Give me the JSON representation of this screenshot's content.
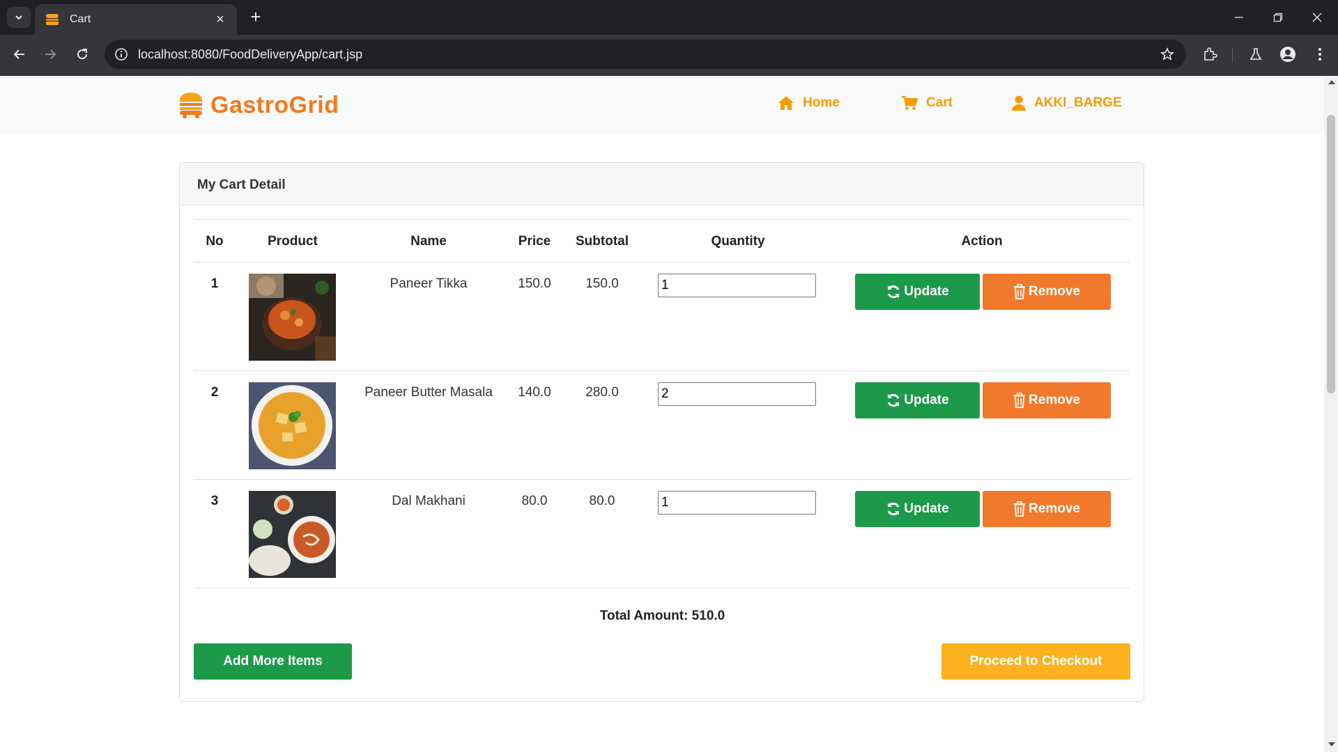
{
  "browser": {
    "tab_title": "Cart",
    "url": "localhost:8080/FoodDeliveryApp/cart.jsp"
  },
  "site": {
    "brand": "GastroGrid",
    "nav": {
      "home": "Home",
      "cart": "Cart",
      "user": "AKKI_BARGE"
    },
    "colors": {
      "brand_orange": "#f07b1e",
      "nav_yellow": "#f59c00",
      "update_green": "#1c9a4a",
      "remove_orange": "#f0792b",
      "checkout_yellow": "#fbb21e"
    }
  },
  "cart": {
    "title": "My Cart Detail",
    "headers": {
      "no": "No",
      "product": "Product",
      "name": "Name",
      "price": "Price",
      "subtotal": "Subtotal",
      "quantity": "Quantity",
      "action": "Action"
    },
    "rows": [
      {
        "no": "1",
        "name": "Paneer Tikka",
        "price": "150.0",
        "subtotal": "150.0",
        "quantity": "1",
        "image": "paneer-tikka-dish"
      },
      {
        "no": "2",
        "name": "Paneer Butter Masala",
        "price": "140.0",
        "subtotal": "280.0",
        "quantity": "2",
        "image": "paneer-butter-masala-bowl"
      },
      {
        "no": "3",
        "name": "Dal Makhani",
        "price": "80.0",
        "subtotal": "80.0",
        "quantity": "1",
        "image": "dal-makhani-bowl"
      }
    ],
    "update_label": "Update",
    "remove_label": "Remove",
    "total_text": "Total Amount: 510.0",
    "add_more_label": "Add More Items",
    "checkout_label": "Proceed to Checkout"
  }
}
